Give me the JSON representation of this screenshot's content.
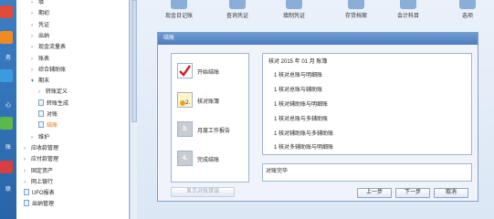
{
  "iconstrip": {
    "labels": [
      "务",
      "心",
      "账",
      "联"
    ]
  },
  "tree": {
    "nodes": [
      {
        "label": "填",
        "indent": 1,
        "kind": "arrow"
      },
      {
        "label": "期初",
        "indent": 1,
        "kind": "arrow"
      },
      {
        "label": "凭证",
        "indent": 1,
        "kind": "arrow"
      },
      {
        "label": "出纳",
        "indent": 1,
        "kind": "arrow"
      },
      {
        "label": "现金流量表",
        "indent": 1,
        "kind": "arrow"
      },
      {
        "label": "账表",
        "indent": 1,
        "kind": "arrow"
      },
      {
        "label": "综合辅助账",
        "indent": 1,
        "kind": "arrow"
      },
      {
        "label": "期末",
        "indent": 1,
        "kind": "open"
      },
      {
        "label": "转账定义",
        "indent": 2,
        "kind": "arrow"
      },
      {
        "label": "转账生成",
        "indent": 2,
        "kind": "doc"
      },
      {
        "label": "对账",
        "indent": 2,
        "kind": "doc"
      },
      {
        "label": "结账",
        "indent": 2,
        "kind": "doc",
        "selected": true
      },
      {
        "label": "维护",
        "indent": 1,
        "kind": "arrow"
      },
      {
        "label": "应收款管理",
        "indent": 0,
        "kind": "arrow"
      },
      {
        "label": "应付款管理",
        "indent": 0,
        "kind": "arrow"
      },
      {
        "label": "固定资产",
        "indent": 0,
        "kind": "arrow"
      },
      {
        "label": "网上银行",
        "indent": 0,
        "kind": "arrow"
      },
      {
        "label": "UFO报表",
        "indent": 0,
        "kind": "doc"
      },
      {
        "label": "出纳管理",
        "indent": 0,
        "kind": "doc"
      }
    ]
  },
  "toolbar": {
    "items": [
      "现金日记账",
      "查询凭证",
      "填制凭证",
      "存货档案",
      "会计科目",
      "选项"
    ]
  },
  "dialog": {
    "title": "结账",
    "steps": [
      {
        "label": "开始结账",
        "icon": "check"
      },
      {
        "label": "核对账簿",
        "icon": "2."
      },
      {
        "label": "月度工作报告",
        "icon": "3."
      },
      {
        "label": "完成结账",
        "icon": "4."
      }
    ],
    "report": {
      "header": "核对 2015 年 01 月 账簿",
      "items": [
        "1 核对总账与明细账",
        "1 核对总账与辅助账",
        "1 核对辅助账与明细账",
        "1 核对总账与多辅助账",
        "1 核对辅助账与多辅助账",
        "1 核对多辅助账与明细账"
      ]
    },
    "result_text": "对账完毕",
    "buttons": {
      "show_errors": "显示对账错误",
      "prev": "上一步",
      "next": "下一步",
      "cancel": "取消"
    }
  },
  "colors": {
    "selected_node": "#e07010",
    "title_bar": "#5a88c6"
  }
}
